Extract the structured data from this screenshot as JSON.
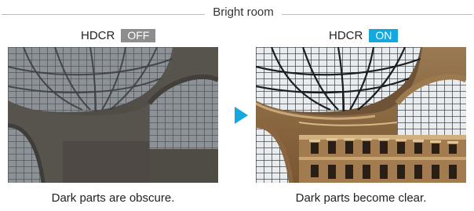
{
  "header": {
    "title": "Bright room"
  },
  "panels": [
    {
      "label": "HDCR",
      "state": "OFF",
      "caption": "Dark parts are obscure."
    },
    {
      "label": "HDCR",
      "state": "ON",
      "caption": "Dark parts become clear."
    }
  ],
  "icons": {
    "divider_arrow": "play-arrow-icon"
  },
  "colors": {
    "on_badge": "#15a8df",
    "off_badge": "#8d8d8d",
    "arrow": "#15a8df"
  }
}
